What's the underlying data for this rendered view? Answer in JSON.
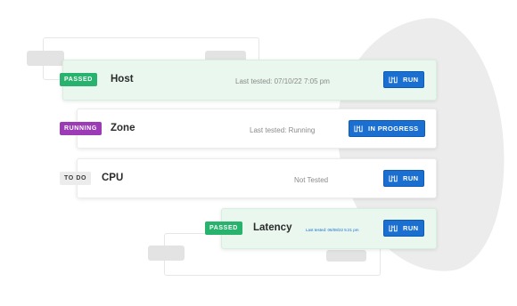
{
  "rows": [
    {
      "name": "Host",
      "badge": "PASSED",
      "status_text": "Last tested: 07/10/22 7:05 pm",
      "button_label": "RUN"
    },
    {
      "name": "Zone",
      "badge": "RUNNING",
      "status_text": "Last tested: Running",
      "button_label": "IN PROGRESS"
    },
    {
      "name": "CPU",
      "badge": "TO DO",
      "status_text": "Not Tested",
      "button_label": "RUN"
    },
    {
      "name": "Latency",
      "badge": "PASSED",
      "status_text": "Last tested: 06/08/22 5:21 pm",
      "button_label": "RUN"
    }
  ],
  "icons": {
    "run_button_icon": "test-tubes-icon"
  },
  "colors": {
    "passed": "#27b26d",
    "running": "#9b3bb6",
    "todo": "#ececec",
    "button": "#1b6fd0",
    "passed_row_bg": "#e9f7ee"
  }
}
